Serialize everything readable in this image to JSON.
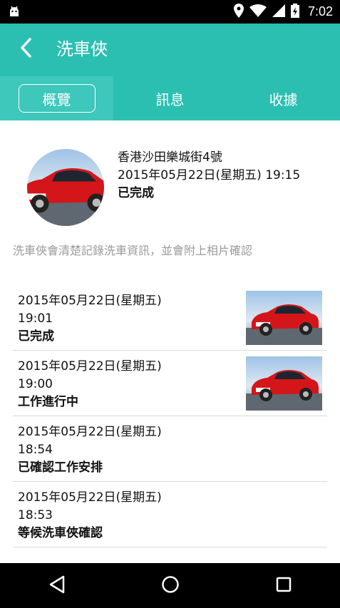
{
  "status_bar": {
    "time": "7:02"
  },
  "app_bar": {
    "title": "洗車俠"
  },
  "tabs": [
    {
      "label": "概覽",
      "active": true
    },
    {
      "label": "訊息",
      "active": false
    },
    {
      "label": "收據",
      "active": false
    }
  ],
  "summary": {
    "address": "香港沙田樂城街4號",
    "datetime": "2015年05月22日(星期五) 19:15",
    "status": "已完成"
  },
  "description": "洗車俠會清楚記錄洗車資訊，並會附上相片確認",
  "history": [
    {
      "date": "2015年05月22日(星期五)",
      "time": "19:01",
      "status": "已完成",
      "has_photo": true
    },
    {
      "date": "2015年05月22日(星期五)",
      "time": "19:00",
      "status": "工作進行中",
      "has_photo": true
    },
    {
      "date": "2015年05月22日(星期五)",
      "time": "18:54",
      "status": "已確認工作安排",
      "has_photo": false
    },
    {
      "date": "2015年05月22日(星期五)",
      "time": "18:53",
      "status": "等候洗車俠確認",
      "has_photo": false
    }
  ],
  "colors": {
    "accent": "#2bbfb2",
    "accent_active_tab": "#3ec7bb"
  },
  "icons": [
    "android-icon",
    "location-icon",
    "wifi-icon",
    "signal-icon",
    "battery-icon",
    "back-arrow-icon",
    "nav-back-icon",
    "nav-home-icon",
    "nav-recents-icon"
  ]
}
